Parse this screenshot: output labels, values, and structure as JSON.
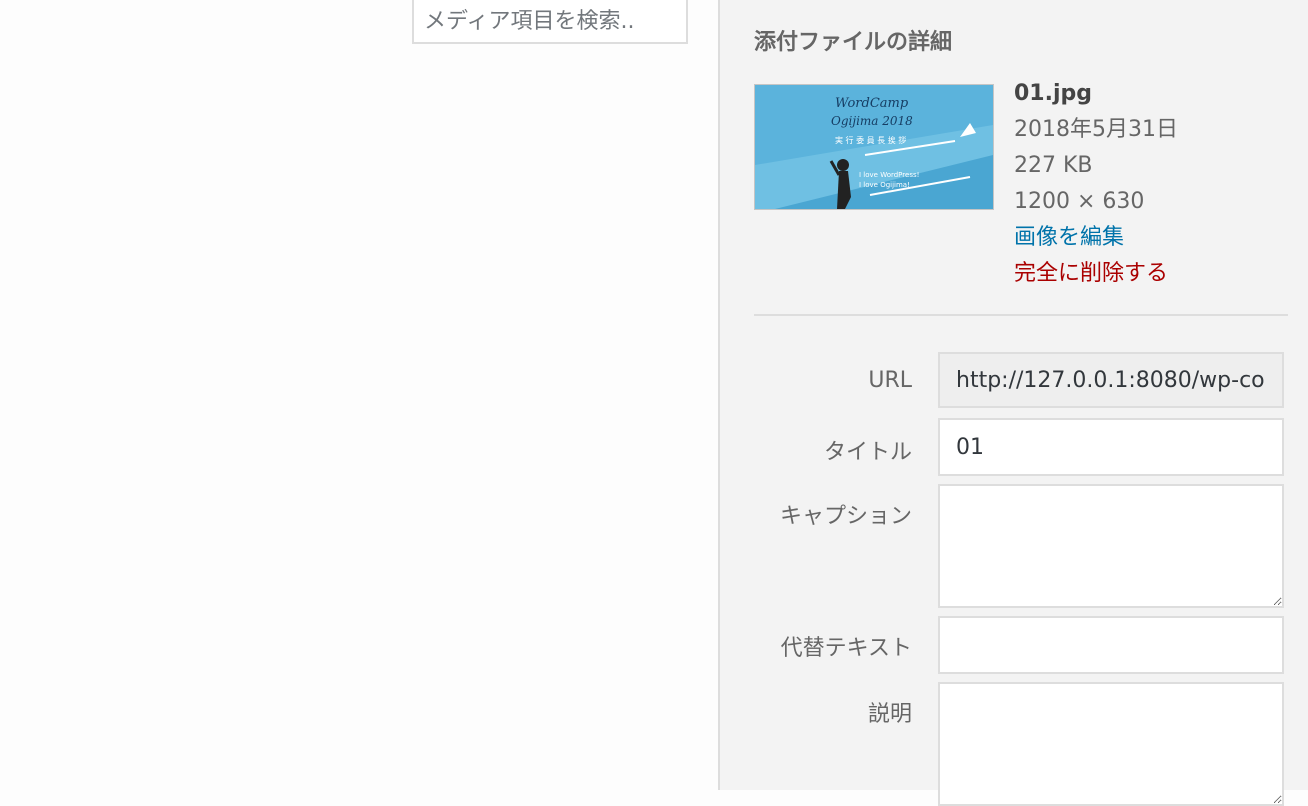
{
  "search": {
    "placeholder": "メディア項目を検索.."
  },
  "details": {
    "heading": "添付ファイルの詳細",
    "thumbnail": {
      "line1": "WordCamp",
      "line2": "Ogijima 2018",
      "line3": "実 行 委 員 長 挨 拶",
      "line4": "I love WordPress!",
      "line5": "I love Ogijima!"
    },
    "filename": "01.jpg",
    "date": "2018年5月31日",
    "filesize": "227 KB",
    "dimensions": "1200 × 630",
    "edit_label": "画像を編集",
    "delete_label": "完全に削除する"
  },
  "fields": {
    "url_label": "URL",
    "url_value": "http://127.0.0.1:8080/wp-co",
    "title_label": "タイトル",
    "title_value": "01",
    "caption_label": "キャプション",
    "caption_value": "",
    "alt_label": "代替テキスト",
    "alt_value": "",
    "description_label": "説明",
    "description_value": ""
  },
  "colors": {
    "link": "#0073aa",
    "delete": "#aa0000",
    "annotation": "#e8402a",
    "thumbnail_bg": "#5bb3dc"
  }
}
